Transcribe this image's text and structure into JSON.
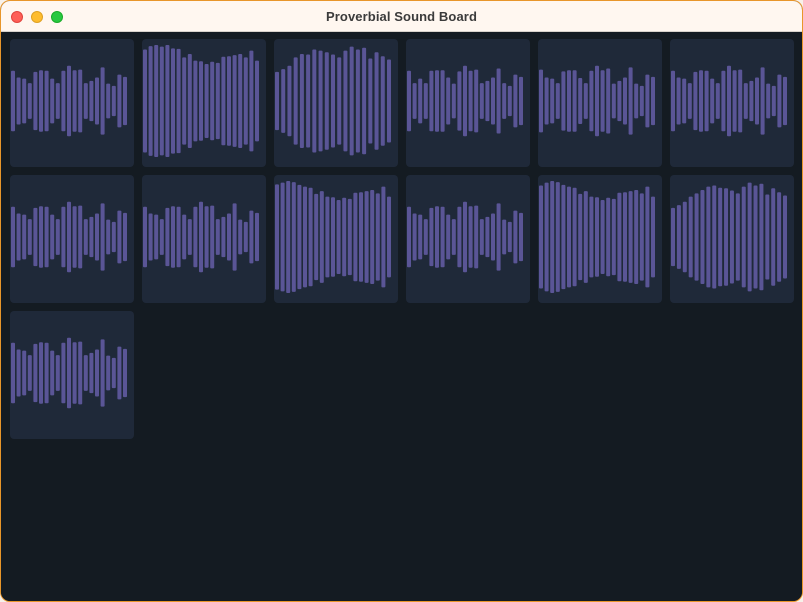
{
  "window": {
    "title": "Proverbial Sound Board"
  },
  "colors": {
    "window_border": "#e8962a",
    "titlebar": "#fff7f0",
    "background": "#141b22",
    "tile": "#1f2939",
    "waveform": "#5a5596"
  },
  "icons": {
    "close": "close-circle-icon",
    "minimize": "minimize-circle-icon",
    "zoom": "zoom-circle-icon",
    "tile_content": "waveform-icon"
  },
  "sound_tiles": [
    {
      "waveform": [
        0.54,
        0.42,
        0.4,
        0.32,
        0.52,
        0.55,
        0.54,
        0.4,
        0.32,
        0.54,
        0.63,
        0.55,
        0.56,
        0.32,
        0.36,
        0.42,
        0.6,
        0.31,
        0.27,
        0.47,
        0.43
      ]
    },
    {
      "waveform": [
        0.92,
        0.98,
        1.0,
        0.97,
        1.0,
        0.94,
        0.93,
        0.78,
        0.84,
        0.72,
        0.71,
        0.66,
        0.7,
        0.68,
        0.79,
        0.8,
        0.82,
        0.84,
        0.78,
        0.9,
        0.72
      ]
    },
    {
      "waveform": [
        0.52,
        0.57,
        0.63,
        0.78,
        0.84,
        0.83,
        0.92,
        0.9,
        0.87,
        0.83,
        0.78,
        0.9,
        0.97,
        0.92,
        0.95,
        0.76,
        0.87,
        0.8,
        0.74
      ]
    },
    {
      "waveform": [
        0.54,
        0.32,
        0.4,
        0.32,
        0.54,
        0.55,
        0.55,
        0.42,
        0.31,
        0.53,
        0.63,
        0.54,
        0.56,
        0.32,
        0.36,
        0.42,
        0.58,
        0.32,
        0.27,
        0.47,
        0.43
      ]
    },
    {
      "waveform": [
        0.56,
        0.42,
        0.4,
        0.32,
        0.53,
        0.55,
        0.55,
        0.41,
        0.32,
        0.54,
        0.63,
        0.55,
        0.58,
        0.31,
        0.36,
        0.42,
        0.6,
        0.31,
        0.27,
        0.47,
        0.43
      ]
    },
    {
      "waveform": [
        0.54,
        0.42,
        0.4,
        0.32,
        0.52,
        0.55,
        0.54,
        0.4,
        0.32,
        0.54,
        0.63,
        0.55,
        0.56,
        0.32,
        0.36,
        0.42,
        0.6,
        0.31,
        0.27,
        0.47,
        0.43
      ]
    },
    {
      "waveform": [
        0.54,
        0.42,
        0.4,
        0.32,
        0.52,
        0.55,
        0.54,
        0.4,
        0.32,
        0.54,
        0.63,
        0.55,
        0.56,
        0.32,
        0.36,
        0.42,
        0.6,
        0.31,
        0.27,
        0.47,
        0.43
      ]
    },
    {
      "waveform": [
        0.54,
        0.42,
        0.4,
        0.32,
        0.52,
        0.55,
        0.54,
        0.4,
        0.32,
        0.54,
        0.63,
        0.55,
        0.56,
        0.32,
        0.36,
        0.42,
        0.6,
        0.31,
        0.27,
        0.47,
        0.43
      ]
    },
    {
      "waveform": [
        0.94,
        0.97,
        1.0,
        0.98,
        0.93,
        0.9,
        0.88,
        0.77,
        0.82,
        0.72,
        0.71,
        0.66,
        0.7,
        0.68,
        0.79,
        0.8,
        0.82,
        0.84,
        0.78,
        0.9,
        0.72
      ]
    },
    {
      "waveform": [
        0.54,
        0.42,
        0.4,
        0.32,
        0.52,
        0.55,
        0.54,
        0.4,
        0.32,
        0.54,
        0.63,
        0.55,
        0.56,
        0.32,
        0.36,
        0.42,
        0.6,
        0.31,
        0.27,
        0.47,
        0.43
      ]
    },
    {
      "waveform": [
        0.92,
        0.97,
        1.0,
        0.98,
        0.93,
        0.9,
        0.88,
        0.77,
        0.82,
        0.72,
        0.71,
        0.66,
        0.7,
        0.68,
        0.79,
        0.8,
        0.82,
        0.84,
        0.78,
        0.9,
        0.72
      ]
    },
    {
      "waveform": [
        0.52,
        0.57,
        0.63,
        0.72,
        0.78,
        0.84,
        0.9,
        0.92,
        0.88,
        0.87,
        0.83,
        0.78,
        0.9,
        0.97,
        0.92,
        0.95,
        0.76,
        0.87,
        0.8,
        0.74
      ]
    },
    {
      "waveform": [
        0.54,
        0.42,
        0.4,
        0.32,
        0.52,
        0.55,
        0.54,
        0.4,
        0.32,
        0.54,
        0.63,
        0.55,
        0.56,
        0.32,
        0.36,
        0.42,
        0.6,
        0.31,
        0.27,
        0.47,
        0.43
      ]
    }
  ]
}
